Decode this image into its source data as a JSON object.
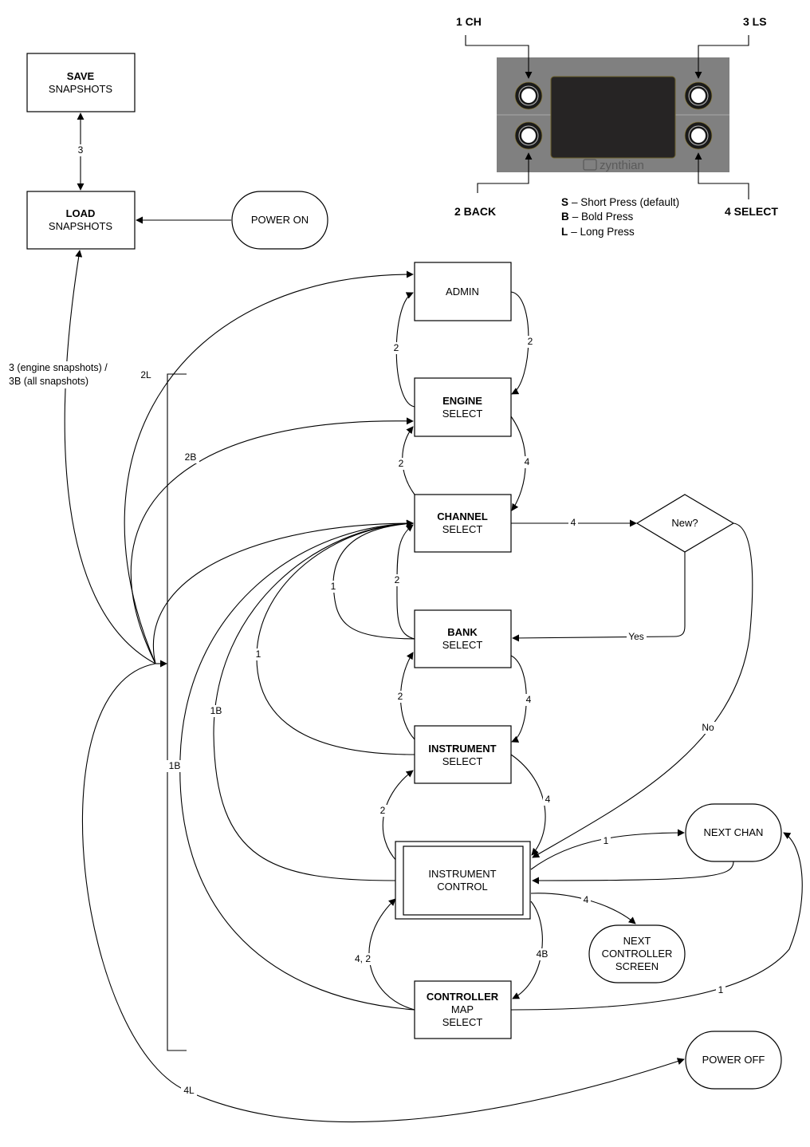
{
  "device": {
    "brand": "zynthian",
    "buttons": [
      {
        "id": "ch",
        "label": "1 CH"
      },
      {
        "id": "back",
        "label": "2 BACK"
      },
      {
        "id": "ls",
        "label": "3 LS"
      },
      {
        "id": "select",
        "label": "4 SELECT"
      }
    ],
    "colors": {
      "panel": "#808080",
      "screen": "#262424",
      "knob": "#1a1a1a"
    }
  },
  "legend": [
    {
      "key": "S",
      "text": "– Short Press (default)"
    },
    {
      "key": "B",
      "text": "– Bold Press"
    },
    {
      "key": "L",
      "text": "– Long Press"
    }
  ],
  "nodes": {
    "save": {
      "bold": "SAVE",
      "lines": [
        "SNAPSHOTS"
      ]
    },
    "load": {
      "bold": "LOAD",
      "lines": [
        "SNAPSHOTS"
      ]
    },
    "power_on": {
      "lines": [
        "POWER ON"
      ]
    },
    "admin": {
      "lines": [
        "ADMIN"
      ]
    },
    "engine": {
      "bold": "ENGINE",
      "lines": [
        "SELECT"
      ]
    },
    "channel": {
      "bold": "CHANNEL",
      "lines": [
        "SELECT"
      ]
    },
    "new": {
      "lines": [
        "New?"
      ]
    },
    "bank": {
      "bold": "BANK",
      "lines": [
        "SELECT"
      ]
    },
    "instrument": {
      "bold": "INSTRUMENT",
      "lines": [
        "SELECT"
      ]
    },
    "instrument_control": {
      "lines": [
        "INSTRUMENT",
        "CONTROL"
      ]
    },
    "next_chan": {
      "lines": [
        "NEXT CHAN"
      ]
    },
    "next_controller": {
      "lines": [
        "NEXT",
        "CONTROLLER",
        "SCREEN"
      ]
    },
    "controller": {
      "bold": "CONTROLLER",
      "lines": [
        "MAP",
        "SELECT"
      ]
    },
    "power_off": {
      "lines": [
        "POWER OFF"
      ]
    }
  },
  "edge_labels": {
    "save_load": "3",
    "hub_load_1": "3 (engine snapshots) /",
    "hub_load_2": "3B (all snapshots)",
    "hub_admin": "2L",
    "hub_engine": "2B",
    "engine_admin": "2",
    "admin_engine": "2",
    "channel_engine": "2",
    "engine_channel": "4",
    "channel_new": "4",
    "new_bank": "Yes",
    "new_ic": "No",
    "bank_channel_1": "1",
    "bank_channel_2": "2",
    "inst_channel": "1",
    "ic_channel": "1B",
    "ctrl_channel": "1B",
    "inst_bank": "2",
    "bank_inst": "4",
    "ic_inst": "2",
    "inst_ic": "4",
    "ic_nextchan": "1",
    "ic_nextctrl": "4",
    "ic_ctrl": "4B",
    "ctrl_ic": "4, 2",
    "ctrl_nextchan": "1",
    "hub_poweroff": "4L"
  }
}
